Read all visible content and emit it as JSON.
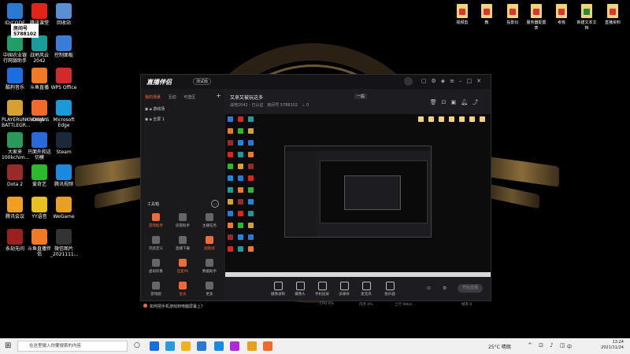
{
  "desktop": {
    "left_icons": [
      {
        "label": "ID/CODE",
        "color": "#2a7ad4"
      },
      {
        "label": "腾讯课堂",
        "color": "#e2231a"
      },
      {
        "label": "回收站",
        "color": "#5a8fd4"
      },
      {
        "label": "中国农业银行网银助手",
        "color": "#1f9e6a"
      },
      {
        "label": "战地风云2042",
        "color": "#1a9c9c"
      },
      {
        "label": "控制面板",
        "color": "#3a7dd8"
      },
      {
        "label": "酷狗音乐",
        "color": "#1a6ee0"
      },
      {
        "label": "斗鱼直播",
        "color": "#f07a26"
      },
      {
        "label": "WPS Office",
        "color": "#d22a2a"
      },
      {
        "label": "PLAYERUNKNOWN'S BATTLEGR...",
        "color": "#d8a030"
      },
      {
        "label": "Origin",
        "color": "#f06a2a"
      },
      {
        "label": "Microsoft Edge",
        "color": "#1a9ad8"
      },
      {
        "label": "大家来100kchim...",
        "color": "#2a9a5a"
      },
      {
        "label": "只面外和这切模",
        "color": "#2a6ad8"
      },
      {
        "label": "Steam",
        "color": "#1b2838"
      },
      {
        "label": "Dota 2",
        "color": "#9a2a2a"
      },
      {
        "label": "爱奇艺",
        "color": "#2aba2a"
      },
      {
        "label": "腾讯视频",
        "color": "#1a8ae0"
      },
      {
        "label": "腾讯会议",
        "color": "#f0a020"
      },
      {
        "label": "YY语音",
        "color": "#e8c020"
      },
      {
        "label": "WeGame",
        "color": "#e8a020"
      },
      {
        "label": "永劫无间",
        "color": "#9a2020"
      },
      {
        "label": "斗鱼直播伴侣",
        "color": "#f07a26"
      },
      {
        "label": "微信图片_2021111...",
        "color": "#333"
      }
    ],
    "id_overlay": {
      "title": "房间号",
      "number": "5788102"
    },
    "right_files": [
      {
        "label": "视频剪",
        "style": "red"
      },
      {
        "label": "教",
        "style": "red"
      },
      {
        "label": "投影仪",
        "style": "red"
      },
      {
        "label": "服务器配置表",
        "style": "red"
      },
      {
        "label": "考核",
        "style": "red"
      },
      {
        "label": "新建文本文档",
        "style": "green"
      },
      {
        "label": "直播资料",
        "style": "red"
      }
    ]
  },
  "app": {
    "logo": "直播伴侣",
    "version": "测试版",
    "left_tabs": [
      "我的场景",
      "互动",
      "可选区"
    ],
    "scenes": [
      "游戏场",
      "全屏 1"
    ],
    "tools_header": "工具箱",
    "tools": [
      {
        "label": "游戏助手",
        "orange": true
      },
      {
        "label": "房管助手",
        "orange": false
      },
      {
        "label": "主播任务",
        "orange": false
      },
      {
        "label": "玩具定义",
        "orange": false
      },
      {
        "label": "直播下载",
        "orange": false
      },
      {
        "label": "副歌屏",
        "orange": true
      },
      {
        "label": "虚拟形象",
        "orange": false
      },
      {
        "label": "连麦PK",
        "orange": true
      },
      {
        "label": "数据助手",
        "orange": false
      },
      {
        "label": "游戏服",
        "orange": false
      },
      {
        "label": "星光",
        "orange": true
      },
      {
        "label": "更多",
        "orange": false
      }
    ],
    "tip": "如何把手机游戏到电脑屏幕上?",
    "stream_title": "又来又被玩这多",
    "badge": "一般",
    "subtitle_game": "战地2042 · 已认证",
    "subtitle_room": "房间号 5788102",
    "subtitle_likes": "0",
    "controls": [
      "摄像录制",
      "摄像头",
      "手机投屏",
      "多媒体",
      "麦克风",
      "扬声器"
    ],
    "start_live": "开始直播",
    "status_items": [
      "CPU 0%",
      "内存 0%",
      "上行 0kb/s",
      "帧率 0"
    ]
  },
  "taskbar": {
    "search_placeholder": "在这里输入你要搜索的内容",
    "weather": "25°C 晴朗",
    "time": "13:24",
    "date": "2021/11/24",
    "lang": "中"
  }
}
